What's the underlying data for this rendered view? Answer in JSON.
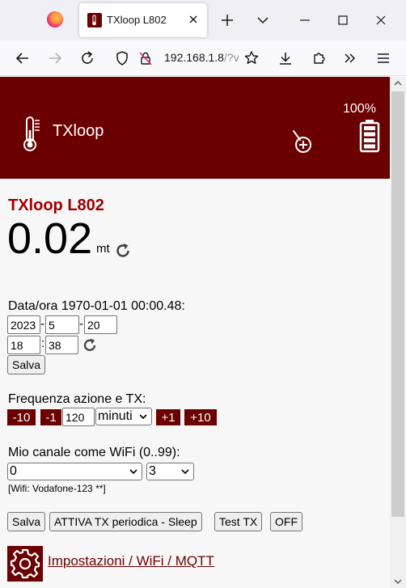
{
  "browser": {
    "tab_title": "TXloop L802",
    "url_host": "192.168.1.8",
    "url_rest": "/?v"
  },
  "header": {
    "app_name": "TXloop",
    "battery_percent": "100%"
  },
  "status": {
    "device_title": "TXloop L802",
    "distance_value": "0.02",
    "distance_unit": "mt"
  },
  "datetime": {
    "label": "Data/ora 1970-01-01 00:00.48:",
    "year": "2023",
    "month": "5",
    "day": "20",
    "hour": "18",
    "minute": "38",
    "date_sep": "-",
    "time_sep": ":",
    "save_label": "Salva"
  },
  "frequency": {
    "label": "Frequenza azione e TX:",
    "minus10": "-10",
    "minus1": "-1",
    "value": "120",
    "unit_selected": "minuti",
    "plus1": "+1",
    "plus10": "+10"
  },
  "channel": {
    "label": "Mio canale come WiFi (0..99):",
    "channel_selected": "0",
    "second_selected": "3",
    "wifi_info": "[Wifi: Vodafone-123 **]"
  },
  "actions": {
    "save": "Salva",
    "activate": "ATTIVA TX periodica - Sleep",
    "test": "Test TX",
    "off": "OFF"
  },
  "settings": {
    "link_text": "Impostazioni / WiFi / MQTT"
  },
  "colors": {
    "brand": "#6b0000",
    "title_red": "#a00000"
  }
}
